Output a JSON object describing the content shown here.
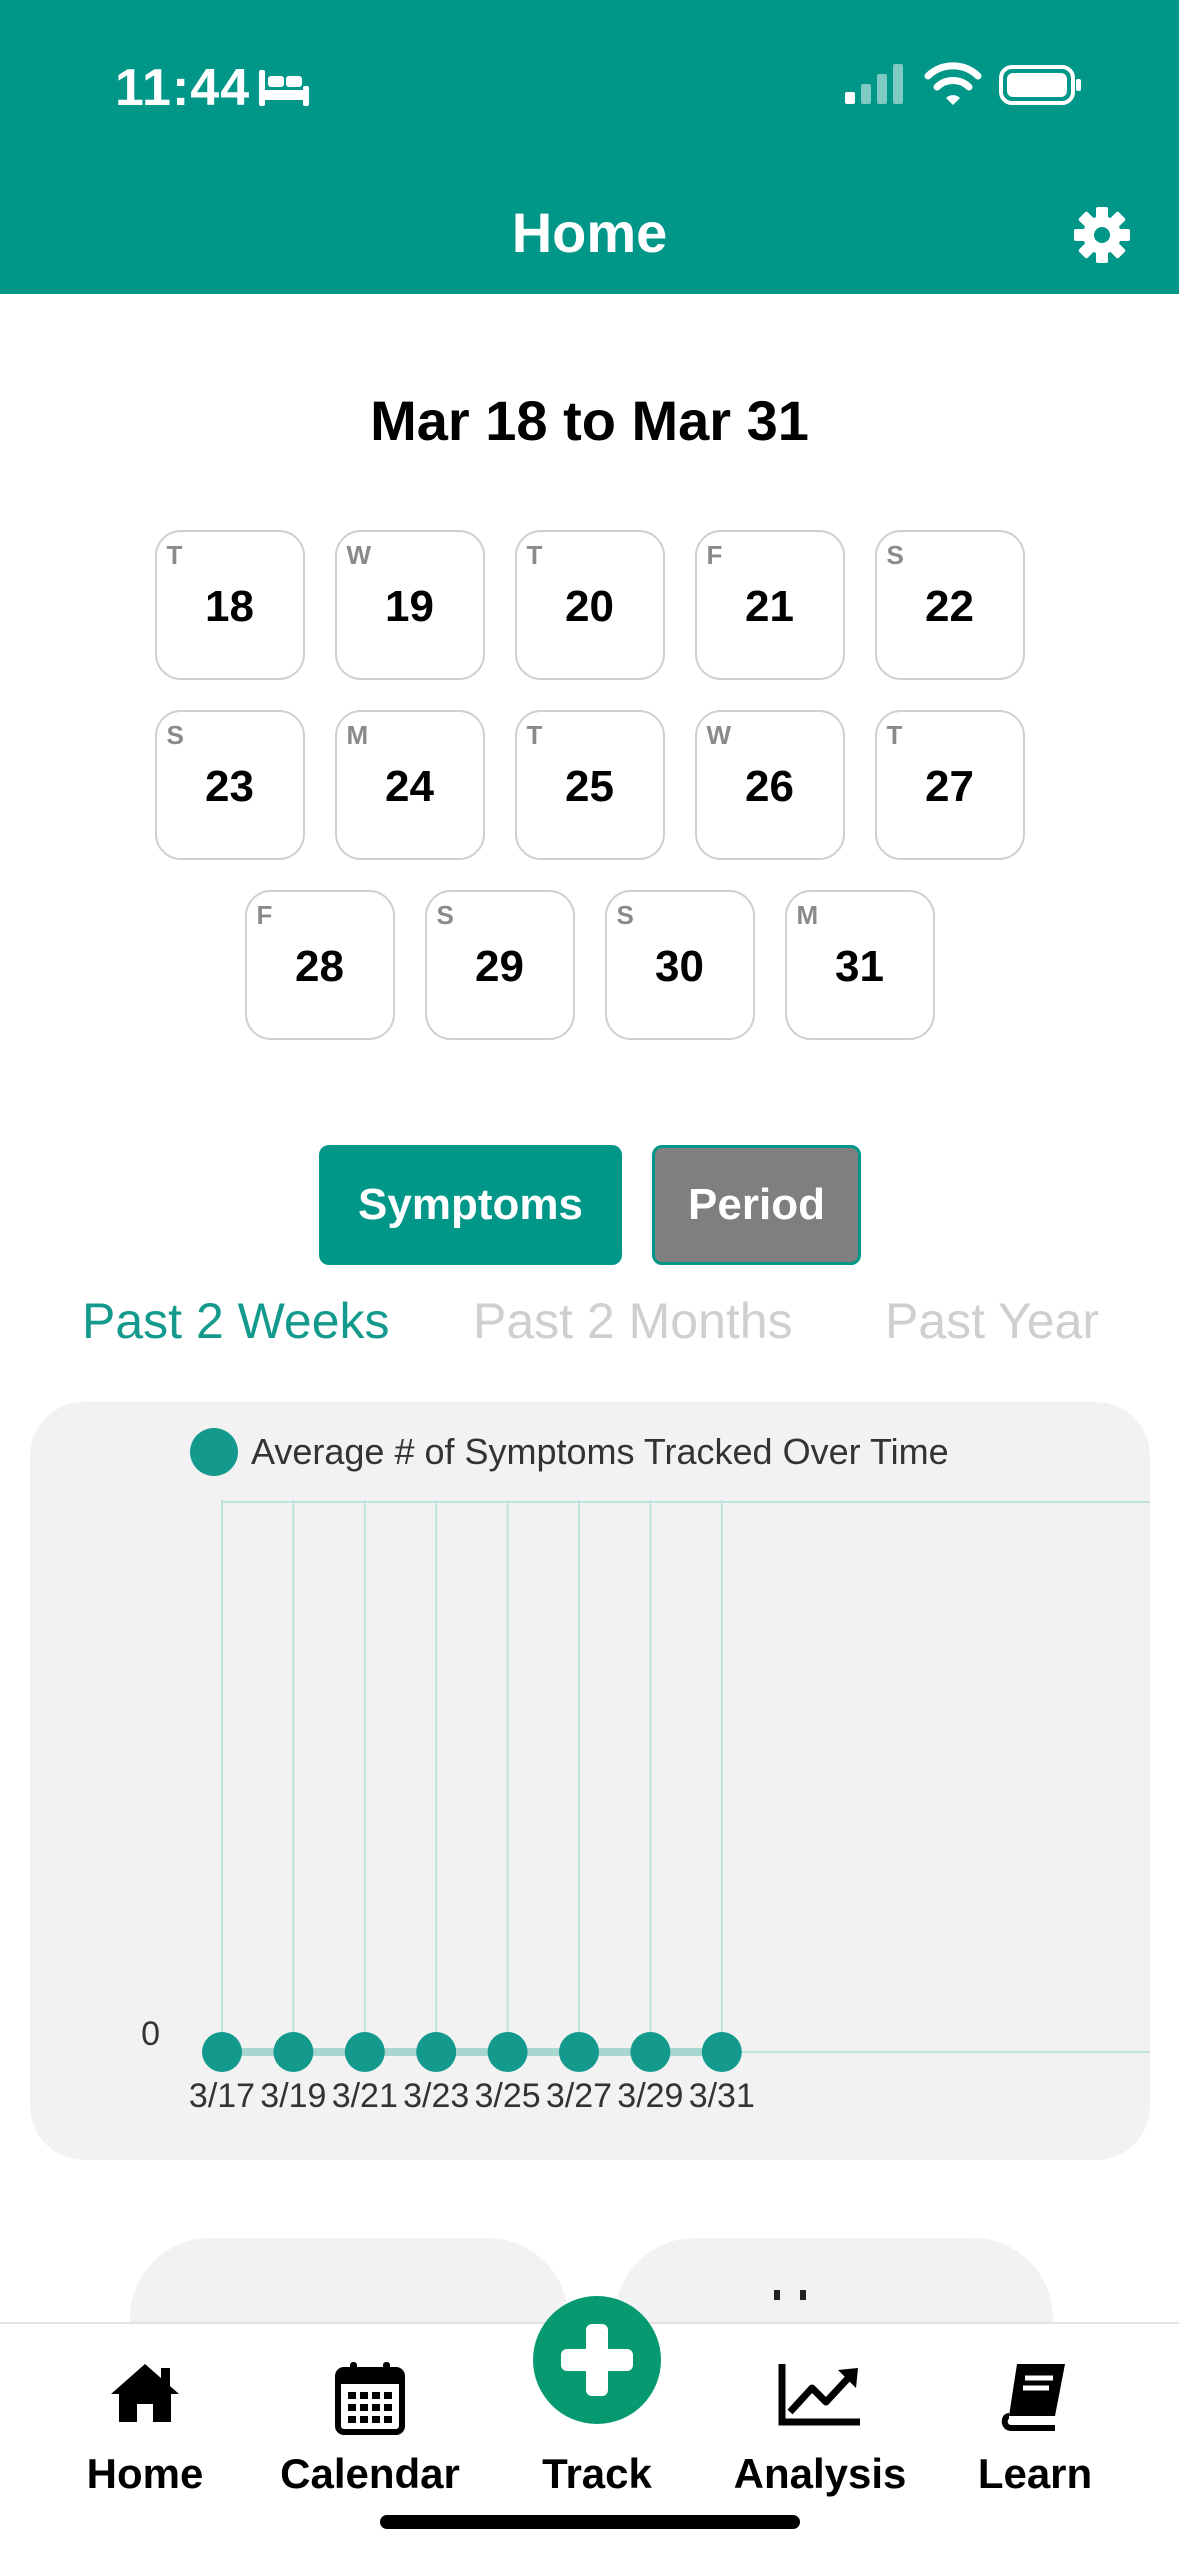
{
  "status_bar": {
    "time": "11:44"
  },
  "header": {
    "title": "Home"
  },
  "date_range": "Mar 18 to Mar 31",
  "days": [
    [
      {
        "letter": "T",
        "num": "18"
      },
      {
        "letter": "W",
        "num": "19"
      },
      {
        "letter": "T",
        "num": "20"
      },
      {
        "letter": "F",
        "num": "21"
      },
      {
        "letter": "S",
        "num": "22"
      }
    ],
    [
      {
        "letter": "S",
        "num": "23"
      },
      {
        "letter": "M",
        "num": "24"
      },
      {
        "letter": "T",
        "num": "25"
      },
      {
        "letter": "W",
        "num": "26"
      },
      {
        "letter": "T",
        "num": "27"
      }
    ],
    [
      {
        "letter": "F",
        "num": "28"
      },
      {
        "letter": "S",
        "num": "29"
      },
      {
        "letter": "S",
        "num": "30"
      },
      {
        "letter": "M",
        "num": "31"
      }
    ]
  ],
  "toggle": {
    "symptoms_label": "Symptoms",
    "period_label": "Period"
  },
  "range_tabs": [
    {
      "label": "Past 2 Weeks",
      "active": true
    },
    {
      "label": "Past 2 Months",
      "active": false
    },
    {
      "label": "Past Year",
      "active": false
    }
  ],
  "colors": {
    "accent": "#009688",
    "series": "#139a8d",
    "track": "#079a71",
    "period_button": "#7f7f7f"
  },
  "chart_data": {
    "type": "line",
    "legend": "Average # of Symptoms Tracked Over Time",
    "x": [
      "3/17",
      "3/19",
      "3/21",
      "3/23",
      "3/25",
      "3/27",
      "3/29",
      "3/31"
    ],
    "series": [
      {
        "name": "Average # of Symptoms Tracked Over Time",
        "values": [
          0,
          0,
          0,
          0,
          0,
          0,
          0,
          0
        ]
      }
    ],
    "y_ticks": [
      "0"
    ],
    "grid": true
  },
  "nav": {
    "items": [
      {
        "label": "Home",
        "icon": "home-icon"
      },
      {
        "label": "Calendar",
        "icon": "calendar-icon"
      },
      {
        "label": "Track",
        "icon": "plus-icon"
      },
      {
        "label": "Analysis",
        "icon": "trending-up-icon"
      },
      {
        "label": "Learn",
        "icon": "book-icon"
      }
    ]
  }
}
